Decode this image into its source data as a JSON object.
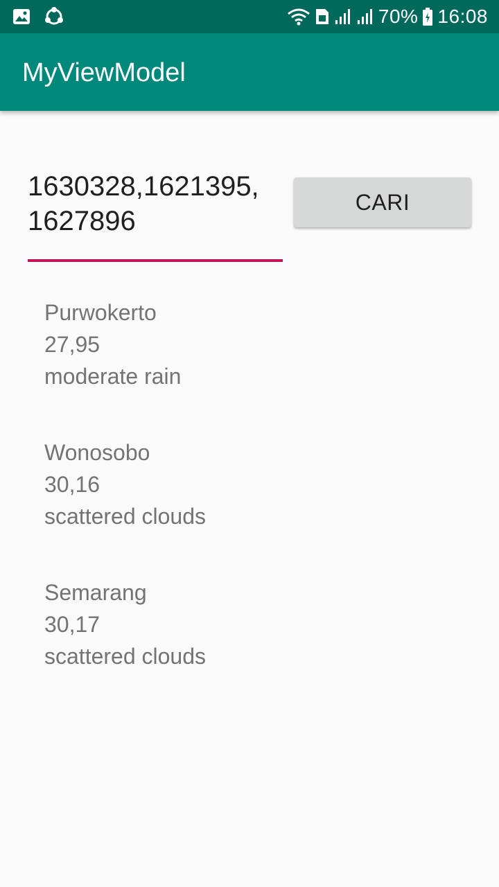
{
  "status_bar": {
    "battery": "70%",
    "time": "16:08"
  },
  "app_bar": {
    "title": "MyViewModel"
  },
  "search": {
    "value": "1630328,1621395,\n1627896",
    "button_label": "CARI"
  },
  "results": [
    {
      "city": "Purwokerto",
      "temperature": "27,95",
      "description": "moderate rain"
    },
    {
      "city": "Wonosobo",
      "temperature": "30,16",
      "description": "scattered clouds"
    },
    {
      "city": "Semarang",
      "temperature": "30,17",
      "description": "scattered clouds"
    }
  ]
}
